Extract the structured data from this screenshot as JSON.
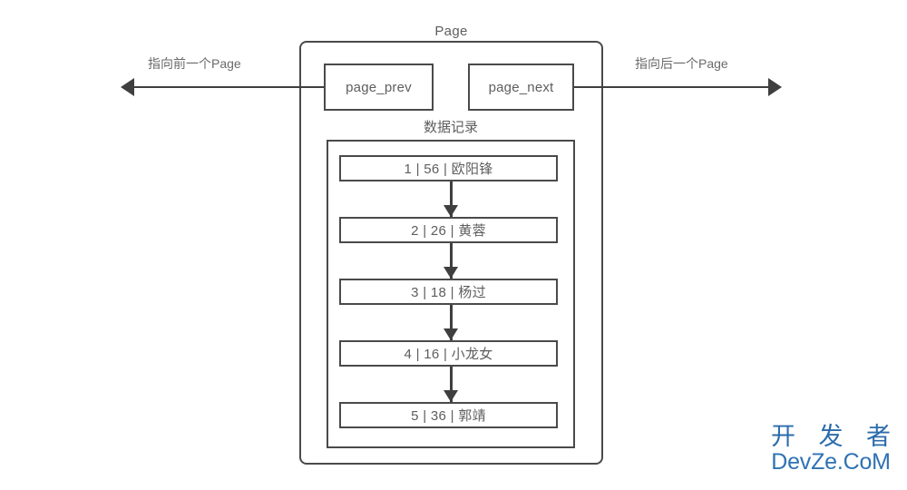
{
  "diagram": {
    "page_label": "Page",
    "records_label": "数据记录",
    "pointers": {
      "prev_box_label": "page_prev",
      "next_box_label": "page_next",
      "prev_arrow_label": "指向前一个Page",
      "next_arrow_label": "指向后一个Page"
    },
    "records": [
      {
        "text": "1 | 56 | 欧阳锋",
        "id": "1",
        "age": "56",
        "name": "欧阳锋"
      },
      {
        "text": "2 | 26 | 黄蓉",
        "id": "2",
        "age": "26",
        "name": "黄蓉"
      },
      {
        "text": "3 | 18 | 杨过",
        "id": "3",
        "age": "18",
        "name": "杨过"
      },
      {
        "text": "4 | 16 | 小龙女",
        "id": "4",
        "age": "16",
        "name": "小龙女"
      },
      {
        "text": "5 | 36 | 郭靖",
        "id": "5",
        "age": "36",
        "name": "郭靖"
      }
    ],
    "colors": {
      "stroke": "#4a4a4a",
      "arrow": "#3f3f3f",
      "text": "#5e5e5e",
      "background": "#ffffff"
    }
  },
  "watermark": {
    "cn": "开 发 者",
    "en": "DevZe.CoM",
    "color": "#2b6cab"
  }
}
